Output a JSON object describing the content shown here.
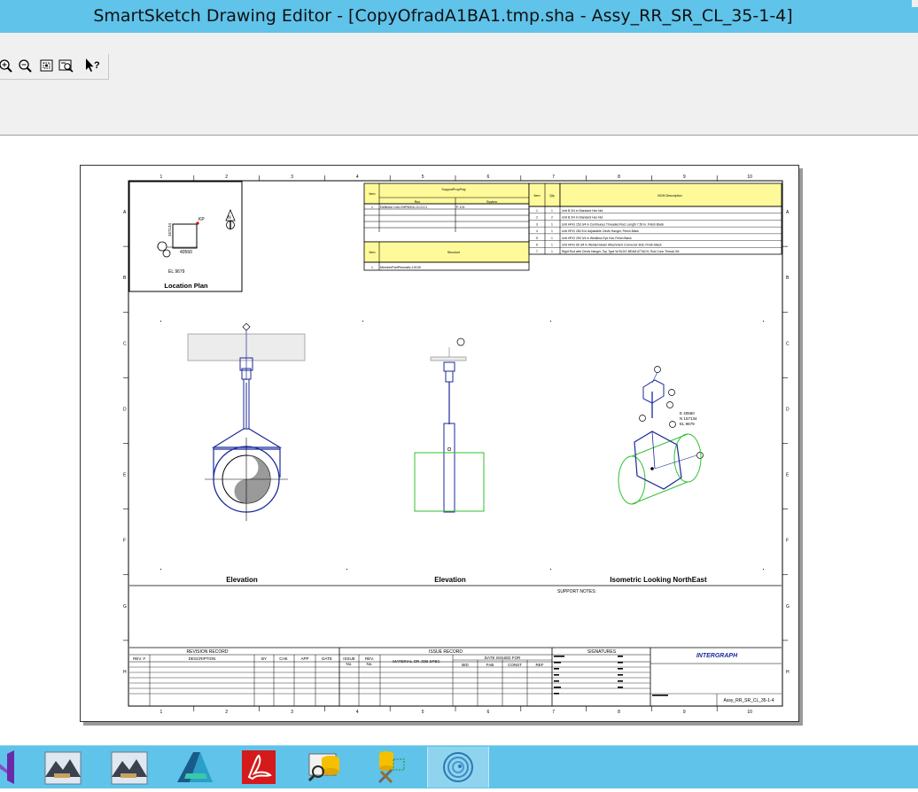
{
  "window": {
    "title": "SmartSketch Drawing Editor - [CopyOfradA1BA1.tmp.sha - Assy_RR_SR_CL_35-1-4]"
  },
  "toolbar": {
    "buttons": [
      "zoom-in-icon",
      "zoom-out-icon",
      "fit-icon",
      "zoom-area-icon",
      "whats-this-help-icon"
    ]
  },
  "drawing": {
    "zone_columns": [
      "1",
      "2",
      "3",
      "4",
      "5",
      "6",
      "7",
      "8",
      "9",
      "10"
    ],
    "zone_rows": [
      "A",
      "B",
      "C",
      "D",
      "E",
      "F",
      "G",
      "H"
    ],
    "location_plan": {
      "label": "Location Plan",
      "north": "N",
      "kp": "KP",
      "coord_n": "157134",
      "coord_e": "40560",
      "elevation": "EL 9679"
    },
    "table": {
      "item_header": "Item",
      "support_prop_header": "SupportPropPsty",
      "run_header": "Run",
      "system_header": "System",
      "row1_item": "1",
      "row1_run": "Deflector Link-SHP6001I-CCCC1",
      "row1_system": "P-101",
      "qty_header": "Qty",
      "bom_header": "BOM Description",
      "bom_rows": [
        {
          "item": "1",
          "qty": "1",
          "desc": "Unit B 3/4 in Standard Hex Nut"
        },
        {
          "item": "2",
          "qty": "2",
          "desc": "Unit B 3/4 in Standard Hex Nut"
        },
        {
          "item": "3",
          "qty": "1",
          "desc": "Unit HFIG 153 3/4 in Continuous Threaded Rod, Length 7.50 in, Finish Black"
        },
        {
          "item": "4",
          "qty": "1",
          "desc": "Unit HFIG 260 8 in Adjustable Clevis Hanger, Finish Black"
        },
        {
          "item": "5",
          "qty": "1",
          "desc": "Unit HFIG 290 3/4 in Weldless Eye Nut, Finish Black"
        },
        {
          "item": "6",
          "qty": "1",
          "desc": "Unit HFIG 66 3/4 in Welded Beam Attachment Connector Bolt, Finish Black"
        },
        {
          "item": "7",
          "qty": "1",
          "desc": "Rigid Rod with Clevis Hanger, Top Type W BLDG BEAM ATTACH, Rod Conn Thread 3/4"
        }
      ],
      "structure_header": "Structure",
      "structure_row": "MemberPartPrismatic-10105"
    },
    "views": {
      "elevation_1": "Elevation",
      "elevation_2": "Elevation",
      "isometric": "Isometric Looking NorthEast",
      "iso_coord_e": "E 40560",
      "iso_coord_n": "N 157134",
      "iso_el": "EL 9679"
    },
    "notes": {
      "label": "SUPPORT NOTES:"
    },
    "title_block": {
      "revision_record": "REVISION RECORD",
      "rev_no": "REV. #",
      "description": "DESCRIPTION",
      "by": "BY",
      "chk": "CHK",
      "app": "APP",
      "date": "DATE",
      "issue_record": "ISSUE RECORD",
      "issue_no_1": "ISSUE",
      "issue_no_2": "No.",
      "rev_no2_1": "REV.",
      "rev_no2_2": "No.",
      "material_spec": "MATERIAL OR JOB SPEC",
      "date_issued_for": "DATE ISSUED FOR",
      "bid": "BID",
      "fab": "FAB",
      "const": "CONST",
      "ref": "REF",
      "signatures": "SIGNATURES",
      "company_logo": "INTERGRAPH",
      "drawing_name": "Assy_RR_SR_CL_35-1-4"
    }
  },
  "taskbar": {
    "items": [
      {
        "name": "visual-studio-icon",
        "active": false
      },
      {
        "name": "hammer-mountain-app-icon-1",
        "active": false
      },
      {
        "name": "hammer-mountain-app-icon-2",
        "active": false
      },
      {
        "name": "autodesk-icon",
        "active": false
      },
      {
        "name": "acrobat-reader-icon",
        "active": false
      },
      {
        "name": "database-search-icon",
        "active": false
      },
      {
        "name": "database-tools-icon",
        "active": false
      },
      {
        "name": "smartsketch-swirl-icon",
        "active": true
      }
    ]
  },
  "colors": {
    "titlebar": "#5fc3ea",
    "taskbar": "#5fc3ea",
    "table_header_fill": "#fffa99",
    "pipe_line": "#1a2a9a",
    "structure_green": "#2fc22f",
    "steel_gray": "#a0a0a0"
  }
}
